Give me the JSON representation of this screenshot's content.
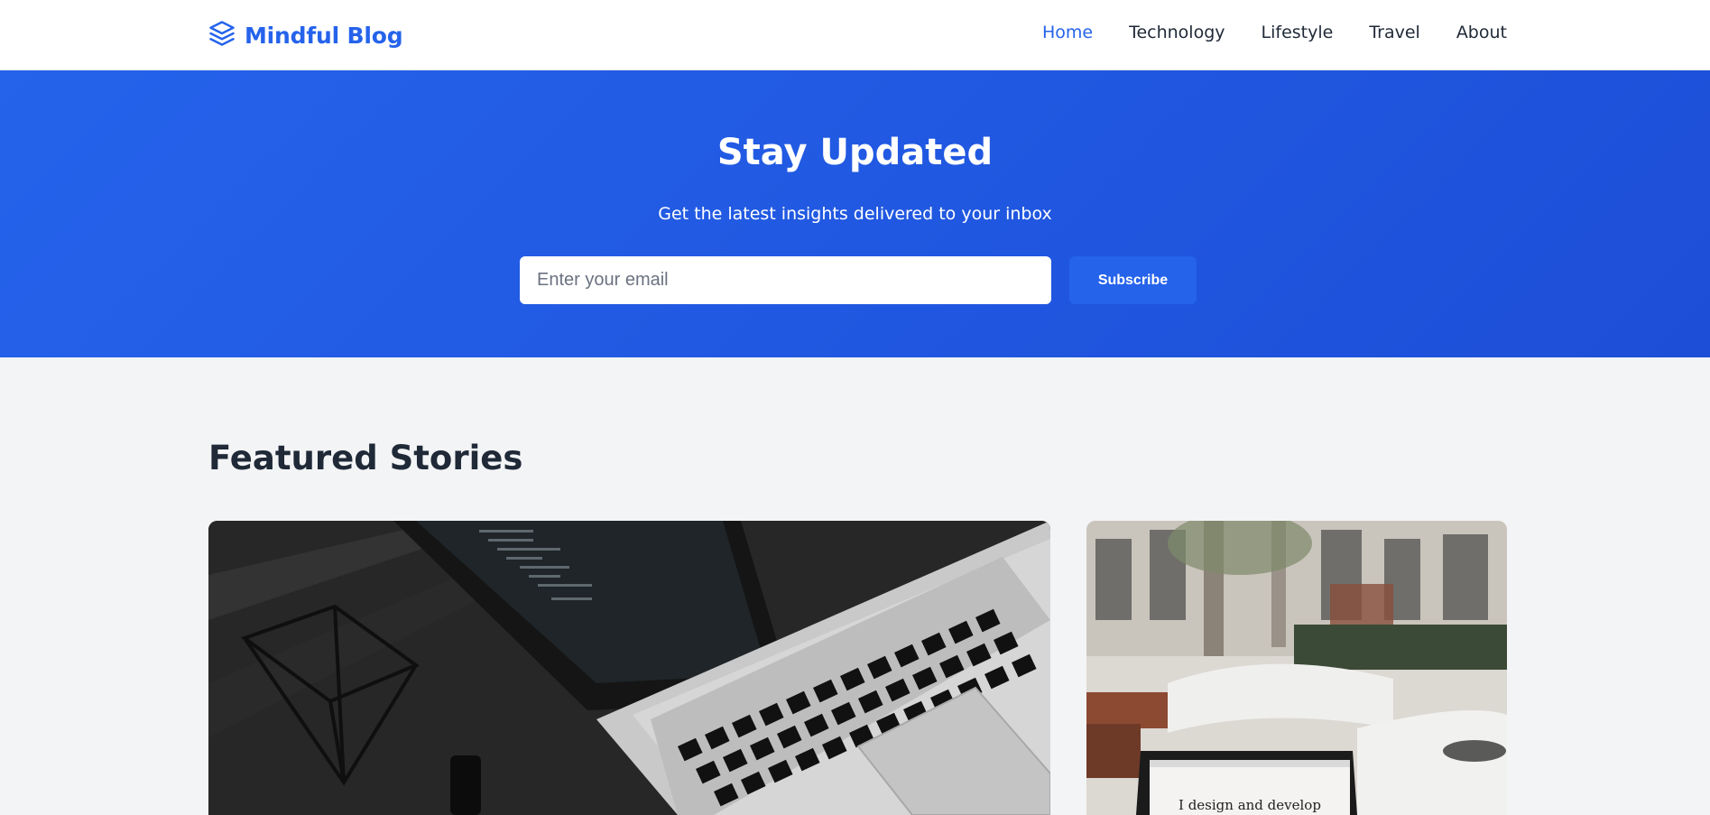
{
  "brand": {
    "name": "Mindful Blog",
    "icon": "layers-icon",
    "color": "#2563eb"
  },
  "nav": {
    "items": [
      {
        "label": "Home",
        "active": true
      },
      {
        "label": "Technology",
        "active": false
      },
      {
        "label": "Lifestyle",
        "active": false
      },
      {
        "label": "Travel",
        "active": false
      },
      {
        "label": "About",
        "active": false
      }
    ]
  },
  "hero": {
    "title": "Stay Updated",
    "subtitle": "Get the latest insights delivered to your inbox",
    "email_placeholder": "Enter your email",
    "subscribe_label": "Subscribe",
    "background": "#2563eb"
  },
  "featured": {
    "title": "Featured Stories",
    "cards": [
      {
        "image": "laptop-keyboard-photo"
      },
      {
        "image": "cafe-laptop-photo",
        "screen_text": "I design and develop"
      }
    ]
  }
}
